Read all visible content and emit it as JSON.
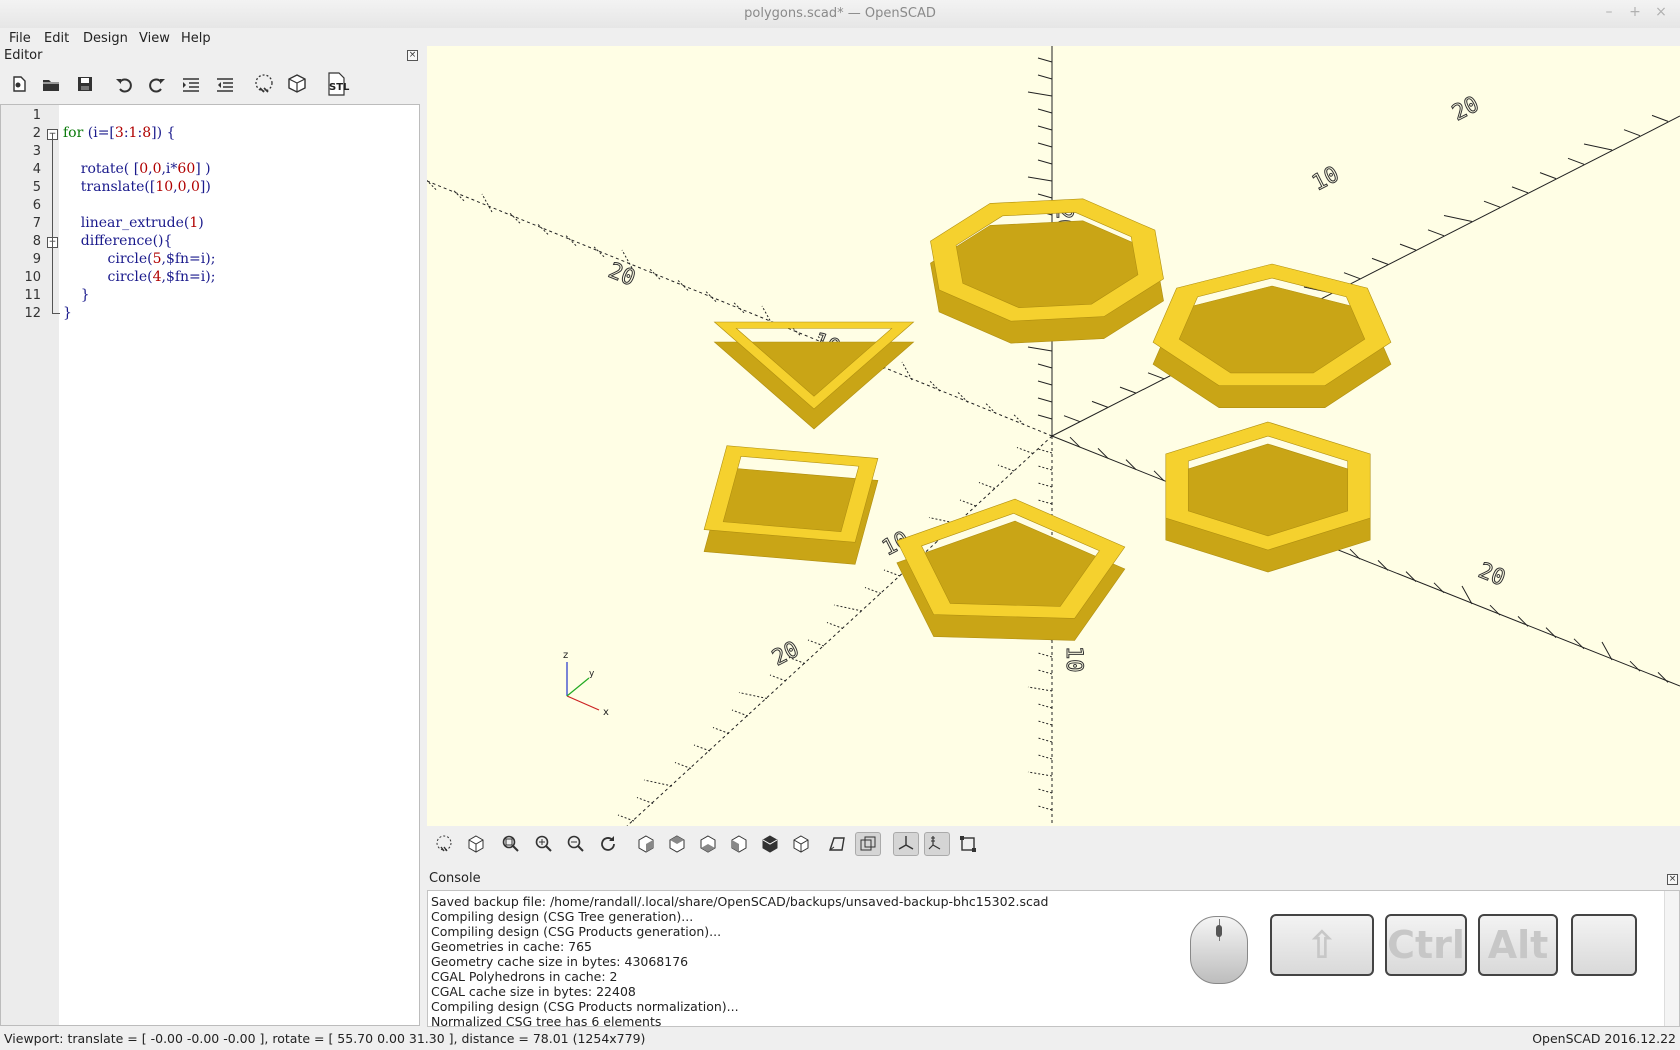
{
  "window": {
    "title": "polygons.scad* — OpenSCAD"
  },
  "menu": [
    "File",
    "Edit",
    "Design",
    "View",
    "Help"
  ],
  "editor": {
    "title": "Editor",
    "toolbar_icons": [
      "new-file-icon",
      "open-file-icon",
      "save-file-icon",
      "undo-icon",
      "redo-icon",
      "indent-icon",
      "unindent-icon",
      "preview-icon",
      "render-icon",
      "export-stl-icon"
    ],
    "stl_label": "STL",
    "line_numbers": [
      "1",
      "2",
      "3",
      "4",
      "5",
      "6",
      "7",
      "8",
      "9",
      "10",
      "11",
      "12"
    ]
  },
  "code_lines": [
    {
      "n": "1",
      "parts": []
    },
    {
      "n": "2",
      "parts": [
        [
          "kw",
          "for"
        ],
        [
          "br",
          " (i=["
        ],
        [
          "num",
          "3"
        ],
        [
          "br",
          ":"
        ],
        [
          "num",
          "1"
        ],
        [
          "br",
          ":"
        ],
        [
          "num",
          "8"
        ],
        [
          "br",
          "]) {"
        ]
      ]
    },
    {
      "n": "3",
      "parts": []
    },
    {
      "n": "4",
      "parts": [
        [
          "fn",
          "    rotate( ["
        ],
        [
          "num",
          "0"
        ],
        [
          "br",
          ","
        ],
        [
          "num",
          "0"
        ],
        [
          "br",
          ",i*"
        ],
        [
          "num",
          "60"
        ],
        [
          "br",
          "] )"
        ]
      ]
    },
    {
      "n": "5",
      "parts": [
        [
          "fn",
          "    translate(["
        ],
        [
          "num",
          "10"
        ],
        [
          "br",
          ","
        ],
        [
          "num",
          "0"
        ],
        [
          "br",
          ","
        ],
        [
          "num",
          "0"
        ],
        [
          "br",
          "])"
        ]
      ]
    },
    {
      "n": "6",
      "parts": []
    },
    {
      "n": "7",
      "parts": [
        [
          "fn",
          "    linear_extrude("
        ],
        [
          "num",
          "1"
        ],
        [
          "br",
          ")"
        ]
      ]
    },
    {
      "n": "8",
      "parts": [
        [
          "fn",
          "    difference(){"
        ]
      ]
    },
    {
      "n": "9",
      "parts": [
        [
          "fn",
          "          circle("
        ],
        [
          "num",
          "5"
        ],
        [
          "br",
          ",$fn=i);"
        ]
      ]
    },
    {
      "n": "10",
      "parts": [
        [
          "fn",
          "          circle("
        ],
        [
          "num",
          "4"
        ],
        [
          "br",
          ",$fn=i);"
        ]
      ]
    },
    {
      "n": "11",
      "parts": [
        [
          "br",
          "    }"
        ]
      ]
    },
    {
      "n": "12",
      "parts": [
        [
          "br",
          "}"
        ]
      ]
    }
  ],
  "viewport": {
    "axis_labels": {
      "z": "z",
      "y": "y",
      "x": "x"
    },
    "scale_labels": [
      "20",
      "10",
      "10",
      "20",
      "10",
      "20",
      "10",
      "20",
      "10",
      "20"
    ],
    "shape_color": "#f5d12e",
    "shape_dark": "#c9a516",
    "background": "#fffee5"
  },
  "view_toolbar_icons": [
    "preview-icon",
    "render-icon",
    "view-all-icon",
    "zoom-in-icon",
    "zoom-out-icon",
    "reset-view-icon",
    "view-right-icon",
    "view-top-icon",
    "view-bottom-icon",
    "view-left-icon",
    "view-front-icon",
    "view-back-icon",
    "perspective-icon",
    "orthogonal-icon",
    "show-axes-icon",
    "show-scale-ticks-icon",
    "show-edges-icon"
  ],
  "console": {
    "title": "Console",
    "lines": [
      "Saved backup file: /home/randall/.local/share/OpenSCAD/backups/unsaved-backup-bhc15302.scad",
      "Compiling design (CSG Tree generation)...",
      "Compiling design (CSG Products generation)...",
      "Geometries in cache: 765",
      "Geometry cache size in bytes: 43068176",
      "CGAL Polyhedrons in cache: 2",
      "CGAL cache size in bytes: 22408",
      "Compiling design (CSG Products normalization)...",
      "Normalized CSG tree has 6 elements"
    ]
  },
  "keys": {
    "shift": "⇧",
    "ctrl": "Ctrl",
    "alt": "Alt",
    "blank": ""
  },
  "status": {
    "left": "Viewport: translate = [ -0.00 -0.00 -0.00 ], rotate = [ 55.70 0.00 31.30 ], distance = 78.01 (1254x779)",
    "right": "OpenSCAD 2016.12.22"
  }
}
